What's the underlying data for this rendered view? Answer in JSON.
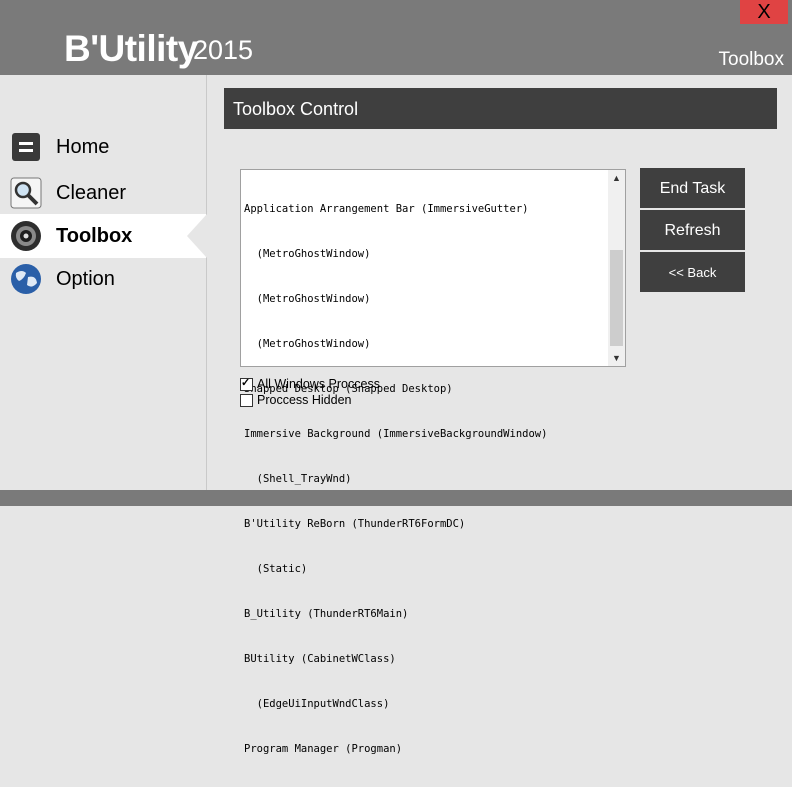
{
  "app": {
    "title": "B'Utility",
    "year": "2015",
    "section": "Toolbox"
  },
  "window": {
    "close_label": "X"
  },
  "sidebar": {
    "items": [
      {
        "label": "Home",
        "icon": "home-icon",
        "active": false
      },
      {
        "label": "Cleaner",
        "icon": "magnifier-icon",
        "active": false
      },
      {
        "label": "Toolbox",
        "icon": "toolbox-icon",
        "active": true
      },
      {
        "label": "Option",
        "icon": "globe-icon",
        "active": false
      }
    ]
  },
  "panel": {
    "title": "Toolbox Control"
  },
  "process_list": [
    "Application Arrangement Bar (ImmersiveGutter)",
    "  (MetroGhostWindow)",
    "  (MetroGhostWindow)",
    "  (MetroGhostWindow)",
    "Snapped Desktop (Snapped Desktop)",
    "Immersive Background (ImmersiveBackgroundWindow)",
    "  (Shell_TrayWnd)",
    "B'Utility ReBorn (ThunderRT6FormDC)",
    "  (Static)",
    "B_Utility (ThunderRT6Main)",
    "BUtility (CabinetWClass)",
    "  (EdgeUiInputWndClass)",
    "Program Manager (Progman)"
  ],
  "buttons": {
    "end_task": "End Task",
    "refresh": "Refresh",
    "back": "<< Back"
  },
  "options": {
    "all_windows": "All Windows Proccess",
    "all_windows_checked": true,
    "hidden": "Proccess Hidden",
    "hidden_checked": false
  },
  "colors": {
    "header": "#7a7a7a",
    "panel": "#3f3f3f",
    "close": "#e04343"
  }
}
